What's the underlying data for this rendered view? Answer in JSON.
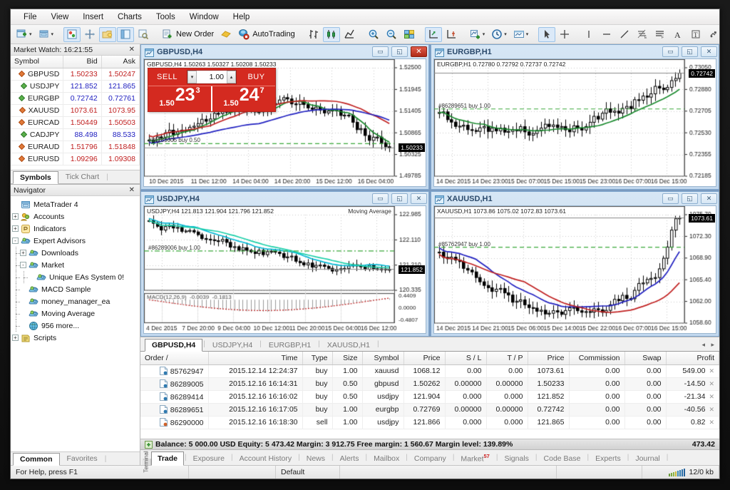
{
  "app": {
    "title": "MetaTrader 4"
  },
  "menu": [
    "File",
    "View",
    "Insert",
    "Charts",
    "Tools",
    "Window",
    "Help"
  ],
  "toolbar": {
    "new_chart": "new-chart-icon",
    "profiles": "profiles-icon",
    "market_watch": "market-watch-icon",
    "data_window": "data-window-icon",
    "navigator": "navigator-icon",
    "terminal": "terminal-icon",
    "strategy_tester": "strategy-tester-icon",
    "new_order_label": "New Order",
    "autotrading_label": "AutoTrading",
    "bar_chart": "bar-chart-icon",
    "candles": "candlestick-icon",
    "line_chart": "line-chart-icon",
    "zoom_in": "zoom-in-icon",
    "zoom_out": "zoom-out-icon",
    "tile_windows": "tile-windows-icon",
    "autoscroll": "autoscroll-icon",
    "chart_shift": "chart-shift-icon",
    "indicators": "indicators-icon",
    "periods": "periods-icon",
    "templates": "templates-icon",
    "cursor": "cursor-icon",
    "crosshair": "crosshair-icon",
    "vertical_line": "vertical-line-icon",
    "horizontal_line": "horizontal-line-icon",
    "trendline": "trendline-icon",
    "fibo": "fibonacci-icon",
    "equidistant": "equidistant-channel-icon",
    "text": "text-icon",
    "text_label": "text-label-icon",
    "shapes": "shapes-icon"
  },
  "market_watch": {
    "title": "Market Watch: 16:21:55",
    "columns": [
      "Symbol",
      "Bid",
      "Ask"
    ],
    "rows": [
      {
        "symbol": "GBPUSD",
        "bid": "1.50233",
        "ask": "1.50247",
        "dir": "down"
      },
      {
        "symbol": "USDJPY",
        "bid": "121.852",
        "ask": "121.865",
        "dir": "up"
      },
      {
        "symbol": "EURGBP",
        "bid": "0.72742",
        "ask": "0.72761",
        "dir": "up"
      },
      {
        "symbol": "XAUUSD",
        "bid": "1073.61",
        "ask": "1073.95",
        "dir": "down"
      },
      {
        "symbol": "EURCAD",
        "bid": "1.50449",
        "ask": "1.50503",
        "dir": "down"
      },
      {
        "symbol": "CADJPY",
        "bid": "88.498",
        "ask": "88.533",
        "dir": "up"
      },
      {
        "symbol": "EURAUD",
        "bid": "1.51796",
        "ask": "1.51848",
        "dir": "down"
      },
      {
        "symbol": "EURUSD",
        "bid": "1.09296",
        "ask": "1.09308",
        "dir": "down"
      }
    ],
    "tabs": [
      "Symbols",
      "Tick Chart"
    ],
    "active_tab": "Symbols"
  },
  "navigator": {
    "title": "Navigator",
    "root": "MetaTrader 4",
    "items": [
      {
        "label": "Accounts",
        "depth": 1,
        "expander": "+",
        "icon": "accounts-icon"
      },
      {
        "label": "Indicators",
        "depth": 1,
        "expander": "+",
        "icon": "indicators-icon"
      },
      {
        "label": "Expert Advisors",
        "depth": 1,
        "expander": "-",
        "icon": "expert-icon"
      },
      {
        "label": "Downloads",
        "depth": 2,
        "expander": "+",
        "icon": "expert-icon"
      },
      {
        "label": "Market",
        "depth": 2,
        "expander": "-",
        "icon": "expert-icon"
      },
      {
        "label": "Unique EAs System 0!",
        "depth": 3,
        "expander": "",
        "icon": "expert-icon"
      },
      {
        "label": "MACD Sample",
        "depth": 2,
        "expander": "",
        "icon": "expert-icon"
      },
      {
        "label": "money_manager_ea",
        "depth": 2,
        "expander": "",
        "icon": "expert-icon"
      },
      {
        "label": "Moving Average",
        "depth": 2,
        "expander": "",
        "icon": "expert-icon"
      },
      {
        "label": "956 more...",
        "depth": 2,
        "expander": "",
        "icon": "globe-icon"
      },
      {
        "label": "Scripts",
        "depth": 1,
        "expander": "+",
        "icon": "scripts-icon"
      }
    ],
    "tabs": [
      "Common",
      "Favorites"
    ],
    "active_tab": "Common"
  },
  "charts": [
    {
      "title": "GBPUSD,H4",
      "ohlc": "GBPUSD,H4  1.50263 1.50327 1.50208 1.50233",
      "position_label": "#86289005 buy 0.50",
      "current_price": "1.50233",
      "y_labels": [
        "1.52500",
        "1.51945",
        "1.51405",
        "1.50865",
        "1.50325",
        "1.49785"
      ],
      "x_labels": [
        "10 Dec 2015",
        "11 Dec 12:00",
        "14 Dec 04:00",
        "14 Dec 20:00",
        "15 Dec 12:00",
        "16 Dec 04:00"
      ],
      "one_click": {
        "sell_label": "SELL",
        "buy_label": "BUY",
        "volume": "1.00",
        "sell_price_pre": "1.50",
        "sell_price_big": "23",
        "sell_price_sup": "3",
        "buy_price_pre": "1.50",
        "buy_price_big": "24",
        "buy_price_sup": "7"
      },
      "has_macd": false,
      "indicator_label": ""
    },
    {
      "title": "EURGBP,H1",
      "ohlc": "EURGBP,H1  0.72780 0.72792 0.72737 0.72742",
      "position_label": "#86289651 buy 1.00",
      "current_price": "0.72742",
      "secondary_price": "0.72705",
      "y_labels": [
        "0.73050",
        "0.72880",
        "0.72705",
        "0.72530",
        "0.72355",
        "0.72185"
      ],
      "x_labels": [
        "14 Dec 2015",
        "14 Dec 23:00",
        "15 Dec 07:00",
        "15 Dec 15:00",
        "15 Dec 23:00",
        "16 Dec 07:00",
        "16 Dec 15:00"
      ],
      "has_macd": false,
      "indicator_label": ""
    },
    {
      "title": "USDJPY,H4",
      "ohlc": "USDJPY,H4  121.813 121.904 121.796 121.852",
      "position_label": "#86289006 buy 1.00",
      "current_price": "121.852",
      "y_labels": [
        "122.985",
        "122.110",
        "121.210",
        "120.335"
      ],
      "x_labels": [
        "4 Dec 2015",
        "7 Dec 20:00",
        "9 Dec 04:00",
        "10 Dec 12:00",
        "11 Dec 20:00",
        "15 Dec 04:00",
        "16 Dec 12:00"
      ],
      "has_macd": true,
      "indicator_label": "Moving Average",
      "macd_label": "MACD(12,26,9)  -0.0039  -0.1813",
      "macd_y": [
        "0.4409",
        "0.0000",
        "-0.4807"
      ]
    },
    {
      "title": "XAUUSD,H1",
      "ohlc": "XAUUSD,H1  1073.86 1075.02 1072.83 1073.61",
      "position_label": "#85762947 buy 1.00",
      "current_price": "1073.61",
      "y_labels": [
        "1075.70",
        "1072.30",
        "1068.90",
        "1065.40",
        "1062.00",
        "1058.60"
      ],
      "x_labels": [
        "14 Dec 2015",
        "14 Dec 21:00",
        "15 Dec 06:00",
        "15 Dec 14:00",
        "15 Dec 22:00",
        "16 Dec 07:00",
        "16 Dec 15:00"
      ],
      "has_macd": false,
      "indicator_label": ""
    }
  ],
  "chart_tabs": {
    "tabs": [
      "GBPUSD,H4",
      "USDJPY,H4",
      "EURGBP,H1",
      "XAUUSD,H1"
    ],
    "active": "GBPUSD,H4"
  },
  "terminal": {
    "side_label": "Terminal",
    "columns": [
      "Order",
      "Time",
      "Type",
      "Size",
      "Symbol",
      "Price",
      "S / L",
      "T / P",
      "Price",
      "Commission",
      "Swap",
      "Profit"
    ],
    "sort_column": "Order",
    "rows": [
      {
        "order": "85762947",
        "time": "2015.12.14 12:24:37",
        "type": "buy",
        "size": "1.00",
        "symbol": "xauusd",
        "open": "1068.12",
        "sl": "0.00",
        "tp": "0.00",
        "price": "1073.61",
        "commission": "0.00",
        "swap": "0.00",
        "profit": "549.00"
      },
      {
        "order": "86289005",
        "time": "2015.12.16 16:14:31",
        "type": "buy",
        "size": "0.50",
        "symbol": "gbpusd",
        "open": "1.50262",
        "sl": "0.00000",
        "tp": "0.00000",
        "price": "1.50233",
        "commission": "0.00",
        "swap": "0.00",
        "profit": "-14.50"
      },
      {
        "order": "86289414",
        "time": "2015.12.16 16:16:02",
        "type": "buy",
        "size": "0.50",
        "symbol": "usdjpy",
        "open": "121.904",
        "sl": "0.000",
        "tp": "0.000",
        "price": "121.852",
        "commission": "0.00",
        "swap": "0.00",
        "profit": "-21.34"
      },
      {
        "order": "86289651",
        "time": "2015.12.16 16:17:05",
        "type": "buy",
        "size": "1.00",
        "symbol": "eurgbp",
        "open": "0.72769",
        "sl": "0.00000",
        "tp": "0.00000",
        "price": "0.72742",
        "commission": "0.00",
        "swap": "0.00",
        "profit": "-40.56"
      },
      {
        "order": "86290000",
        "time": "2015.12.16 16:18:30",
        "type": "sell",
        "size": "1.00",
        "symbol": "usdjpy",
        "open": "121.866",
        "sl": "0.000",
        "tp": "0.000",
        "price": "121.865",
        "commission": "0.00",
        "swap": "0.00",
        "profit": "0.82"
      }
    ],
    "summary": "Balance: 5 000.00 USD  Equity: 5 473.42  Margin: 3 912.75  Free margin: 1 560.67  Margin level: 139.89%",
    "summary_total": "473.42",
    "tabs": [
      "Trade",
      "Exposure",
      "Account History",
      "News",
      "Alerts",
      "Mailbox",
      "Company",
      "Market",
      "Signals",
      "Code Base",
      "Experts",
      "Journal"
    ],
    "active_tab": "Trade",
    "market_badge": "57"
  },
  "status": {
    "help": "For Help, press F1",
    "profile": "Default",
    "traffic": "12/0 kb"
  },
  "colors": {
    "accent_red": "#d42a20",
    "bull": "#ffffff",
    "bear": "#000000",
    "ma_green": "#1a8a2e",
    "ma_blue": "#2020c0",
    "ma_red": "#c02020",
    "ma_cyan": "#00b7d4",
    "ma_teal": "#19cfa8",
    "grid": "#c8c8c8"
  }
}
